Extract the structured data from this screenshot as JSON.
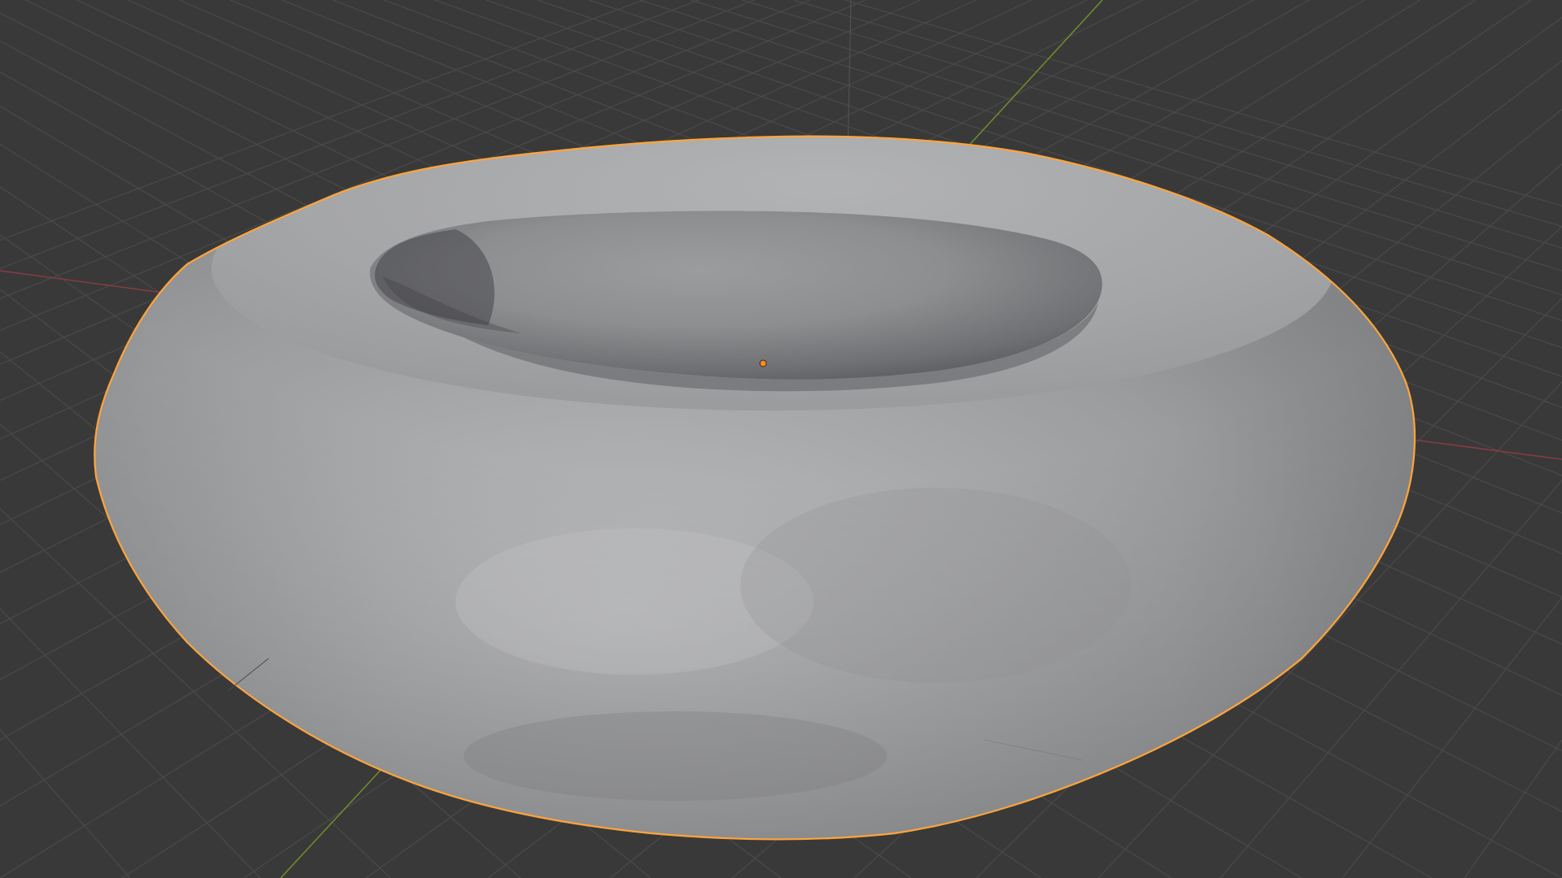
{
  "viewport": {
    "background_color": "#393939",
    "grid_line_color": "#4a4a4a",
    "x_axis_color": "#8a3a44",
    "y_axis_color": "#6f8f2a",
    "z_axis_color": "#5a5a5a",
    "selection_outline_color": "#ffa43a",
    "origin_dot_color": "#ff8a1e",
    "mesh_base_color": "#a3a4a6",
    "selected_object": {
      "type": "torus-like mesh",
      "state": "selected",
      "shading": "solid smooth"
    },
    "icons": [
      "object-origin-icon"
    ]
  }
}
